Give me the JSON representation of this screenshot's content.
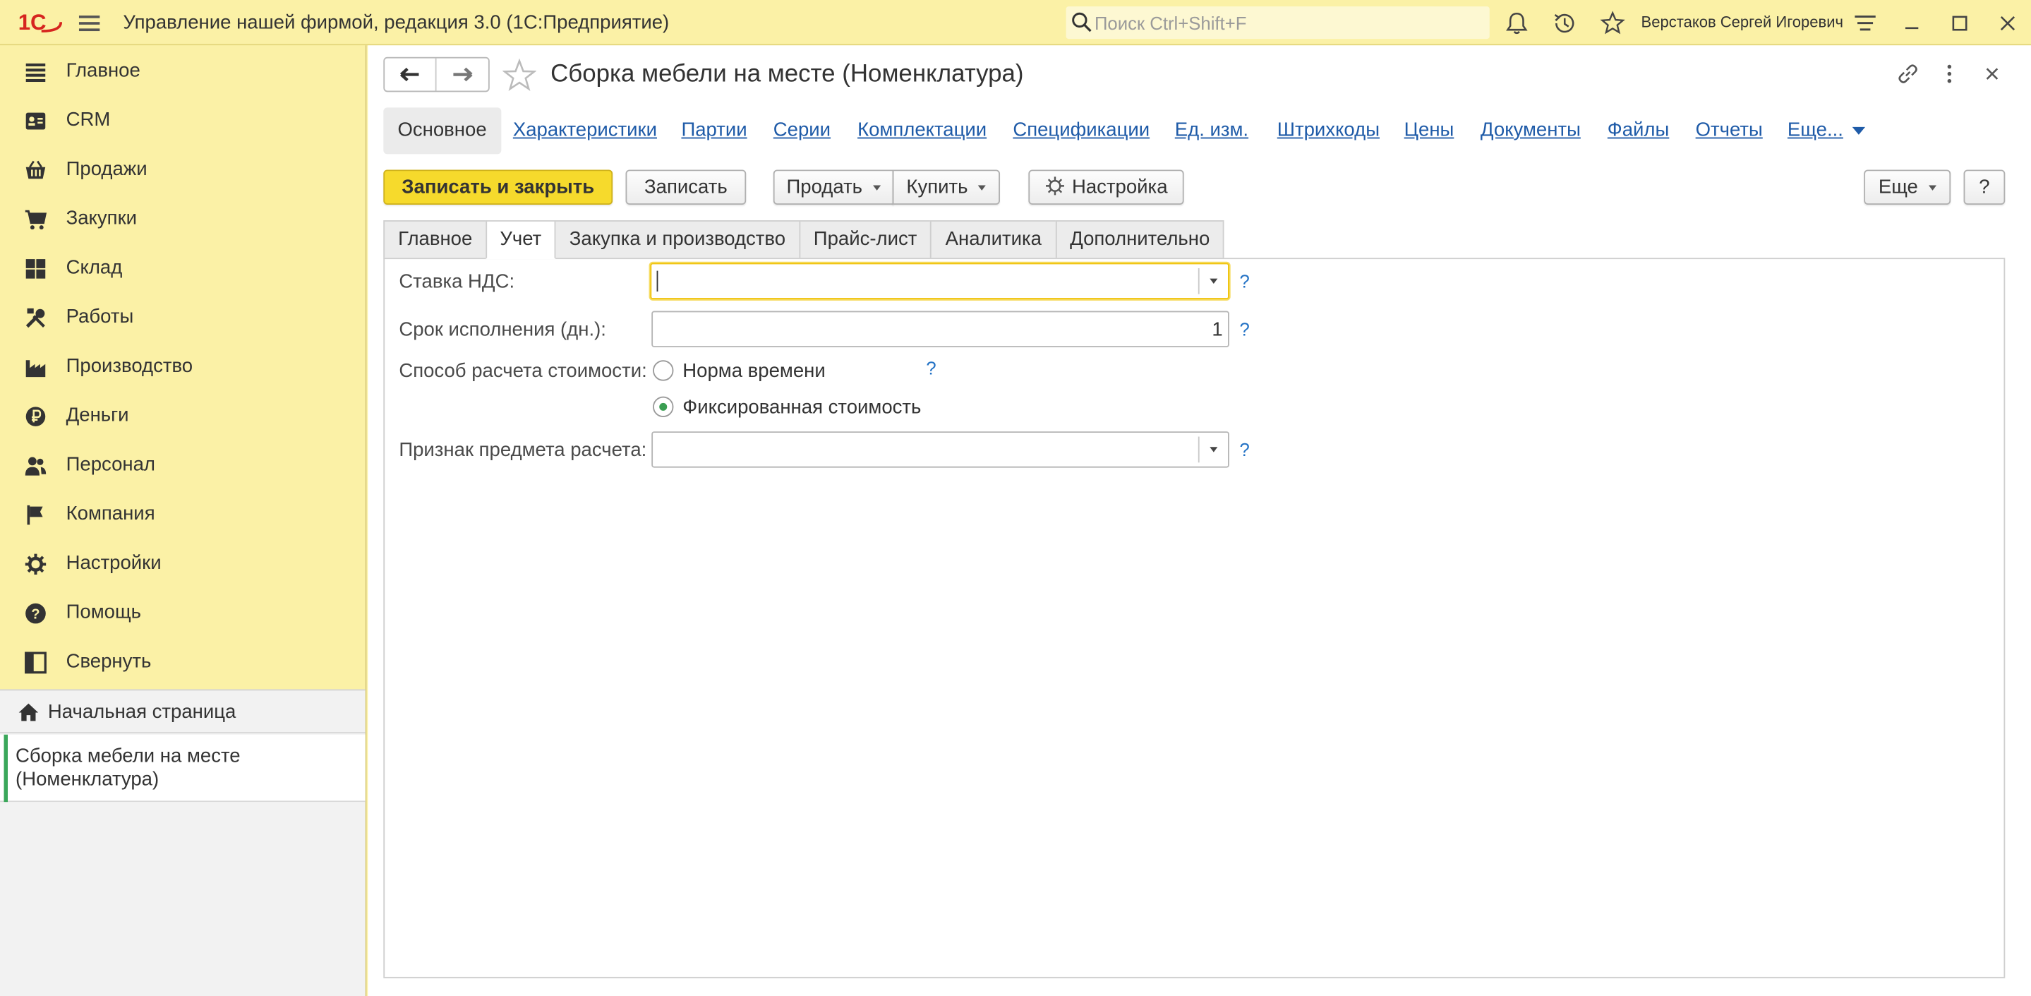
{
  "app": {
    "title": "Управление нашей фирмой, редакция 3.0  (1С:Предприятие)",
    "search_placeholder": "Поиск Ctrl+Shift+F",
    "user_name": "Верстаков Сергей Игоревич",
    "logo_text": "1С"
  },
  "sidebar": {
    "items": [
      {
        "label": "Главное",
        "icon": "list-icon"
      },
      {
        "label": "CRM",
        "icon": "contact-card-icon"
      },
      {
        "label": "Продажи",
        "icon": "shopping-basket-icon"
      },
      {
        "label": "Закупки",
        "icon": "shopping-cart-icon"
      },
      {
        "label": "Склад",
        "icon": "warehouse-grid-icon"
      },
      {
        "label": "Работы",
        "icon": "tools-icon"
      },
      {
        "label": "Производство",
        "icon": "factory-icon"
      },
      {
        "label": "Деньги",
        "icon": "ruble-coin-icon"
      },
      {
        "label": "Персонал",
        "icon": "people-icon"
      },
      {
        "label": "Компания",
        "icon": "flag-icon"
      },
      {
        "label": "Настройки",
        "icon": "gear-icon"
      },
      {
        "label": "Помощь",
        "icon": "help-circle-icon"
      },
      {
        "label": "Свернуть",
        "icon": "collapse-panel-icon"
      }
    ],
    "history": {
      "home": "Начальная страница",
      "current": "Сборка мебели на месте (Номенклатура)"
    }
  },
  "form": {
    "title": "Сборка мебели на месте (Номенклатура)",
    "link_tabs": [
      "Основное",
      "Характеристики",
      "Партии",
      "Серии",
      "Комплектации",
      "Спецификации",
      "Ед. изм.",
      "Штрихкоды",
      "Цены",
      "Документы",
      "Файлы",
      "Отчеты",
      "Еще..."
    ],
    "active_link_tab": "Основное",
    "commands": {
      "save_close": "Записать и закрыть",
      "save": "Записать",
      "sell": "Продать",
      "buy": "Купить",
      "settings": "Настройка",
      "more": "Еще",
      "help": "?"
    },
    "page_tabs": [
      "Главное",
      "Учет",
      "Закупка и производство",
      "Прайс-лист",
      "Аналитика",
      "Дополнительно"
    ],
    "active_page_tab": "Учет",
    "fields": {
      "vat_label": "Ставка НДС:",
      "vat_value": "",
      "term_label": "Срок исполнения (дн.):",
      "term_value": "1",
      "calc_method_label": "Способ расчета стоимости:",
      "calc_options": [
        "Норма времени",
        "Фиксированная стоимость"
      ],
      "calc_selected": "Фиксированная стоимость",
      "subject_label": "Признак предмета расчета:",
      "subject_value": "",
      "help_mark": "?"
    }
  },
  "colors": {
    "panel_yellow": "#fbf1a6",
    "primary_button": "#f6da2c",
    "link_blue": "#1f5ba8",
    "logo_red": "#d6251f",
    "radio_green": "#3a9e52",
    "history_marker": "#3aa75a"
  }
}
